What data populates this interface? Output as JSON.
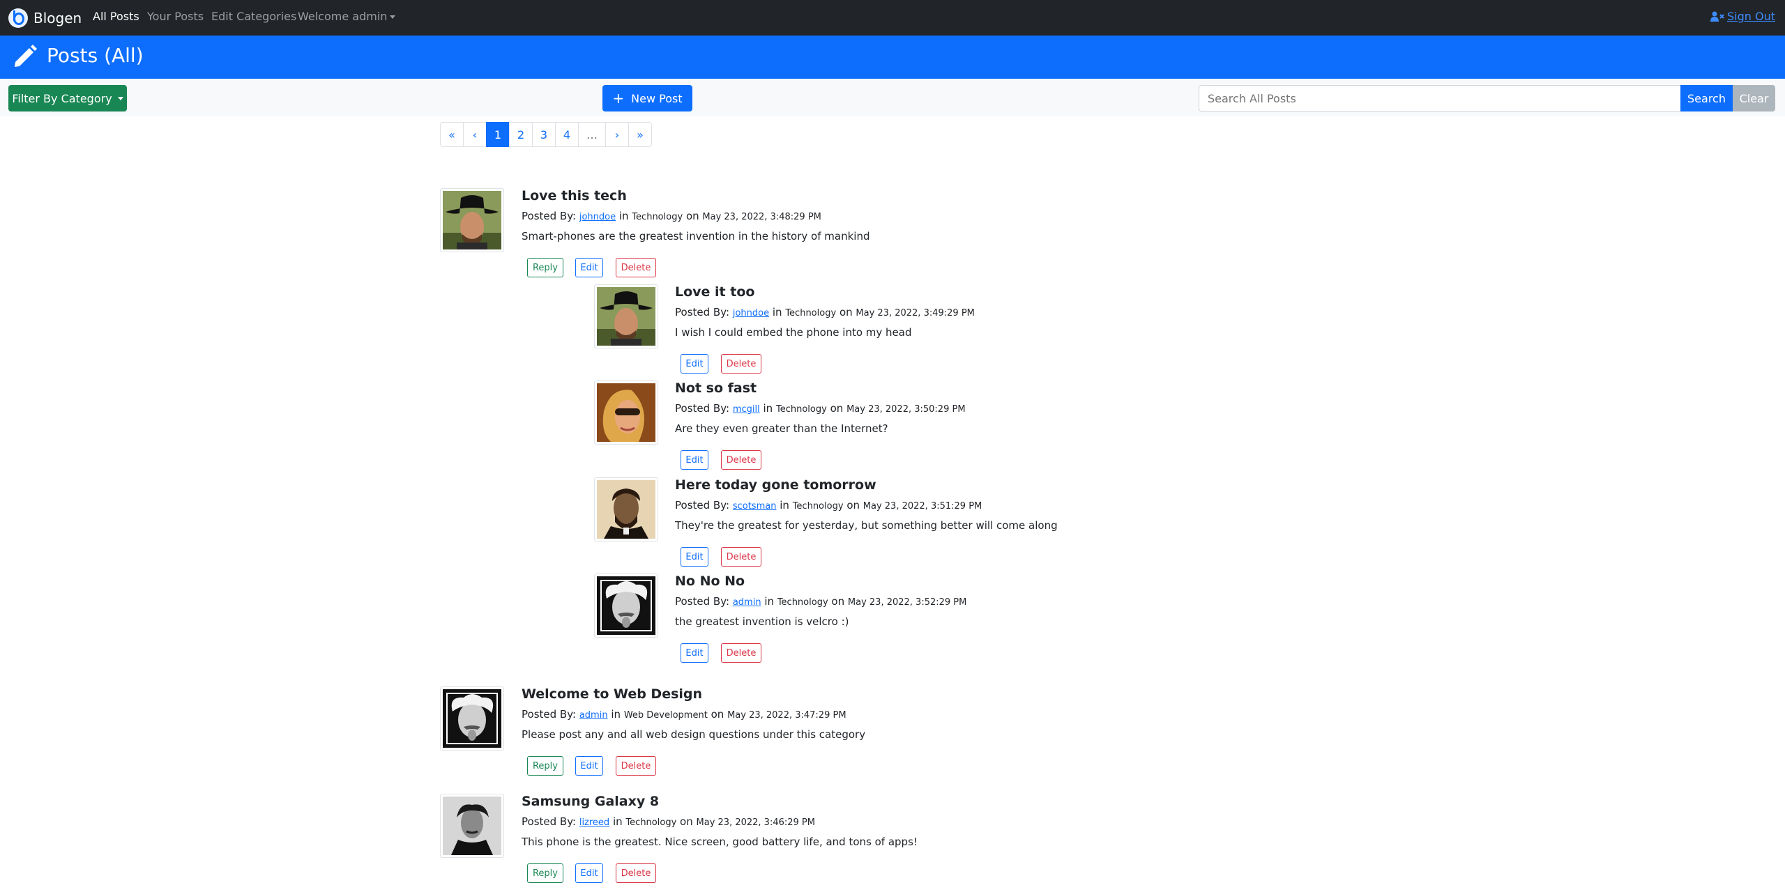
{
  "navbar": {
    "brand": "Blogen",
    "links": [
      "All Posts",
      "Your Posts",
      "Edit Categories"
    ],
    "user_menu": "Welcome admin",
    "signout": "Sign Out"
  },
  "header": {
    "title": "Posts (All)"
  },
  "toolbar": {
    "filter_label": "Filter By Category",
    "new_post_label": "New Post",
    "search_placeholder": "Search All Posts",
    "search_label": "Search",
    "clear_label": "Clear"
  },
  "pagination": [
    "«",
    "‹",
    "1",
    "2",
    "3",
    "4",
    "…",
    "›",
    "»"
  ],
  "actions": {
    "reply": "Reply",
    "edit": "Edit",
    "delete": "Delete"
  },
  "posts": [
    {
      "title": "Love this tech",
      "posted_by": "Posted By:",
      "author": "johndoe",
      "in": "in",
      "category": "Technology",
      "on": "on",
      "date": "May 23, 2022, 3:48:29 PM",
      "body": "Smart-phones are the greatest invention in the history of mankind",
      "avatar": "cowboy-avatar"
    },
    {
      "title": "Love it too",
      "posted_by": "Posted By:",
      "author": "johndoe",
      "in": "in",
      "category": "Technology",
      "on": "on",
      "date": "May 23, 2022, 3:49:29 PM",
      "body": "I wish I could embed the phone into my head",
      "avatar": "cowboy-avatar"
    },
    {
      "title": "Not so fast",
      "posted_by": "Posted By:",
      "author": "mcgill",
      "in": "in",
      "category": "Technology",
      "on": "on",
      "date": "May 23, 2022, 3:50:29 PM",
      "body": "Are they even greater than the Internet?",
      "avatar": "woman-sunglasses-avatar"
    },
    {
      "title": "Here today gone tomorrow",
      "posted_by": "Posted By:",
      "author": "scotsman",
      "in": "in",
      "category": "Technology",
      "on": "on",
      "date": "May 23, 2022, 3:51:29 PM",
      "body": "They're the greatest for yesterday, but something better will come along",
      "avatar": "lincoln-avatar"
    },
    {
      "title": "No No No",
      "posted_by": "Posted By:",
      "author": "admin",
      "in": "in",
      "category": "Technology",
      "on": "on",
      "date": "May 23, 2022, 3:52:29 PM",
      "body": "the greatest invention is velcro :)",
      "avatar": "einstein-avatar"
    },
    {
      "title": "Welcome to Web Design",
      "posted_by": "Posted By:",
      "author": "admin",
      "in": "in",
      "category": "Web Development",
      "on": "on",
      "date": "May 23, 2022, 3:47:29 PM",
      "body": "Please post any and all web design questions under this category",
      "avatar": "einstein-avatar"
    },
    {
      "title": "Samsung Galaxy 8",
      "posted_by": "Posted By:",
      "author": "lizreed",
      "in": "in",
      "category": "Technology",
      "on": "on",
      "date": "May 23, 2022, 3:46:29 PM",
      "body": "This phone is the greatest. Nice screen, good battery life, and tons of apps!",
      "avatar": "poe-avatar"
    }
  ]
}
